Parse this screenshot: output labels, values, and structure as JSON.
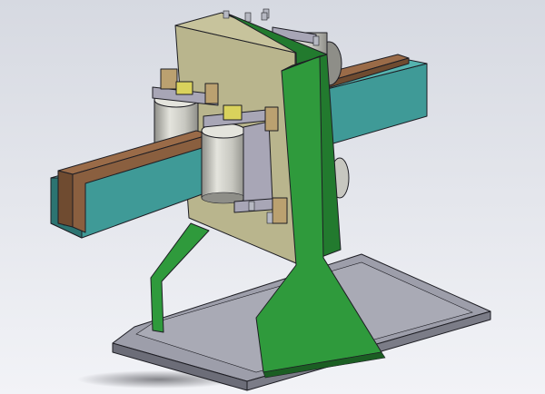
{
  "view": {
    "kind": "3d-cad-assembly-render",
    "background_gradient": [
      "#d6d9e1",
      "#f2f3f7"
    ],
    "shadow_color": "#2a2a30"
  },
  "parts": {
    "base_plate": {
      "color_top": "#9d9eaa",
      "color_side": "#6c6d78"
    },
    "support_stand": {
      "color": "#2f9a3c",
      "color_dark": "#227a2e",
      "color_edge": "#1b5e23"
    },
    "back_plate": {
      "color": "#b9b58d",
      "color_edge": "#8f8b66"
    },
    "rail_beam": {
      "color": "#3f9a97",
      "color_dark": "#2c7471",
      "color_light": "#55b3af"
    },
    "wood_strips": {
      "color": "#9a6b48",
      "color_dark": "#6f4b30"
    },
    "rollers": {
      "color": "#c7c7c0",
      "color_shade": "#8e8e88",
      "color_light": "#e4e4dd"
    },
    "brackets": {
      "color": "#a8a6b6",
      "color_dark": "#7d7b8c"
    },
    "clamp_blocks": {
      "color": "#bba170",
      "color_dark": "#8f7b50"
    },
    "yellow_blocks": {
      "color": "#d9d25c",
      "color_dark": "#a7a03a"
    },
    "bolts": {
      "color": "#b6b8c2",
      "color_dark": "#6e7080"
    }
  }
}
